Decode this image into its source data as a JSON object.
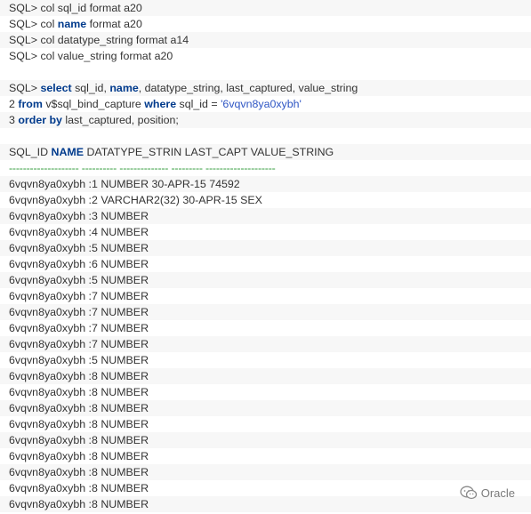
{
  "col_commands": [
    {
      "prompt": "SQL>",
      "text": "col sql_id format a20"
    },
    {
      "prompt": "SQL>",
      "pre": "col",
      "kw": "name",
      "post": "format a20"
    },
    {
      "prompt": "SQL>",
      "text": "col datatype_string format a14"
    },
    {
      "prompt": "SQL>",
      "text": "col value_string format a20"
    }
  ],
  "query": {
    "line1": {
      "prompt": "SQL>",
      "kw1": "select",
      "t1": "sql_id,",
      "kw2": "name",
      "t2": ", datatype_string, last_captured, value_string"
    },
    "line2": {
      "num": "2",
      "kw1": "from",
      "t1": "v$sql_bind_capture",
      "kw2": "where",
      "t2": "sql_id =",
      "str": "'6vqvn8ya0xybh'"
    },
    "line3": {
      "num": "3",
      "kw1": "order by",
      "t1": "last_captured, position;"
    }
  },
  "result": {
    "header": {
      "c1": "SQL_ID",
      "c2": "NAME",
      "c3": "DATATYPE_STRIN LAST_CAPT VALUE_STRING"
    },
    "separator": "-------------------- ---------- -------------- --------- --------------------",
    "rows": [
      "6vqvn8ya0xybh :1 NUMBER 30-APR-15 74592",
      "6vqvn8ya0xybh :2 VARCHAR2(32) 30-APR-15 SEX",
      "6vqvn8ya0xybh :3 NUMBER",
      "6vqvn8ya0xybh :4 NUMBER",
      "6vqvn8ya0xybh :5 NUMBER",
      "6vqvn8ya0xybh :6 NUMBER",
      "6vqvn8ya0xybh :5 NUMBER",
      "6vqvn8ya0xybh :7 NUMBER",
      "6vqvn8ya0xybh :7 NUMBER",
      "6vqvn8ya0xybh :7 NUMBER",
      "6vqvn8ya0xybh :7 NUMBER",
      "6vqvn8ya0xybh :5 NUMBER",
      "6vqvn8ya0xybh :8 NUMBER",
      "6vqvn8ya0xybh :8 NUMBER",
      "6vqvn8ya0xybh :8 NUMBER",
      "6vqvn8ya0xybh :8 NUMBER",
      "6vqvn8ya0xybh :8 NUMBER",
      "6vqvn8ya0xybh :8 NUMBER",
      "6vqvn8ya0xybh :8 NUMBER",
      "6vqvn8ya0xybh :8 NUMBER",
      "6vqvn8ya0xybh :8 NUMBER"
    ]
  },
  "watermark": {
    "icon": "wechat-icon",
    "text": "Oracle"
  },
  "colors": {
    "keyword": "#003a8c",
    "string": "#2f56c4",
    "separator": "#2f9a3a",
    "text": "#333333"
  }
}
